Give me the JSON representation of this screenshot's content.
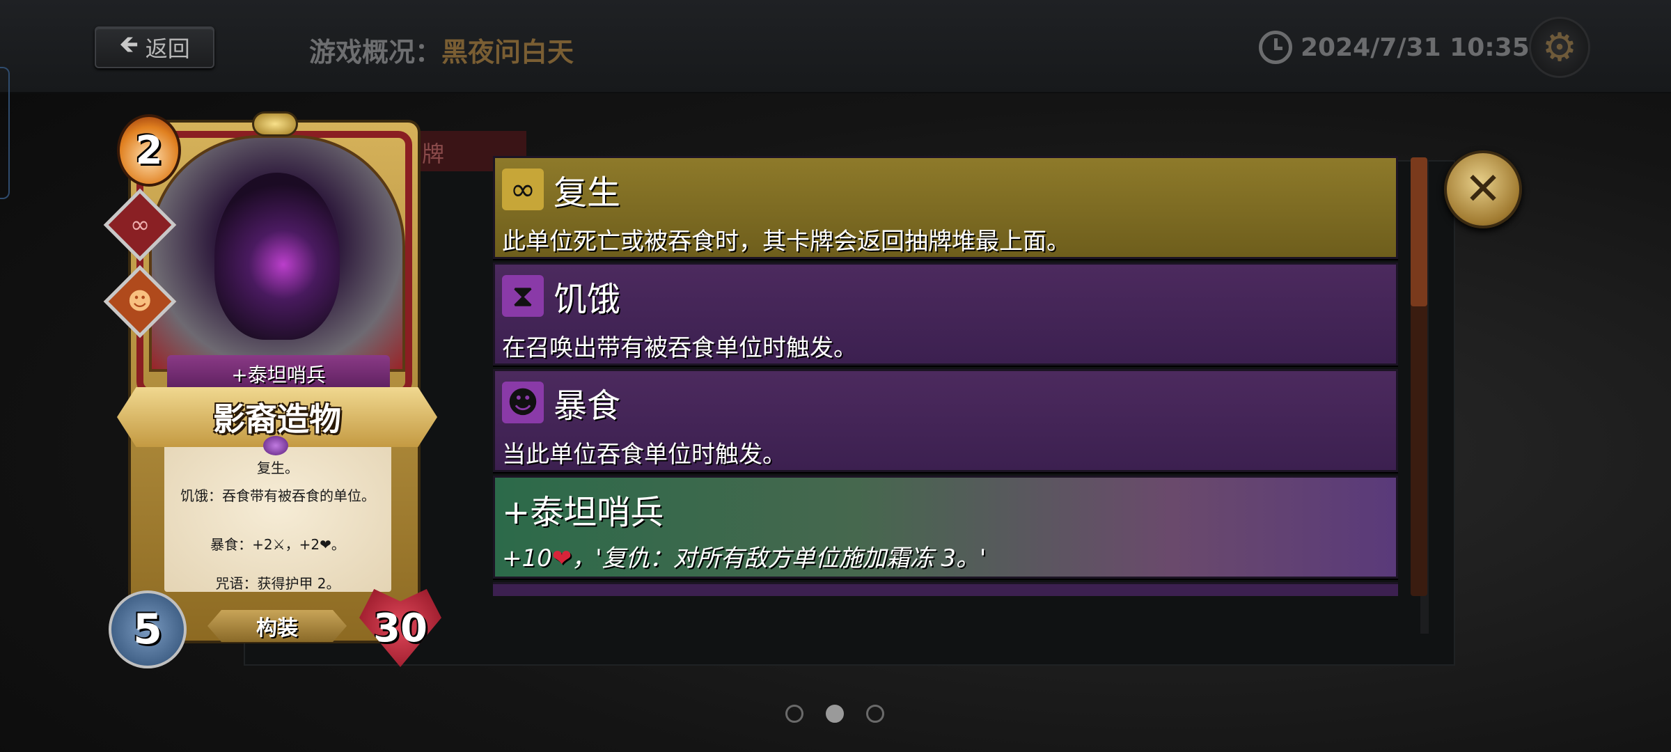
{
  "header": {
    "back_label": "返回",
    "back_arrow": "🡸",
    "overview_prefix": "游戏概况：",
    "overview_name": "黑夜问白天",
    "datetime": "2024/7/31 10:35",
    "settings_glyph": "⚙"
  },
  "panel": {
    "tab_label": "牌",
    "close_glyph": "✕"
  },
  "keywords": [
    {
      "icon_glyph": "∞",
      "title": "复生",
      "desc": "此单位死亡或被吞食时，其卡牌会返回抽牌堆最上面。"
    },
    {
      "icon_glyph": "⧗",
      "title": "饥饿",
      "desc": "在召唤出带有被吞食单位时触发。"
    },
    {
      "icon_glyph": "☻",
      "title": "暴食",
      "desc": "当此单位吞食单位时触发。"
    }
  ],
  "upgrade": {
    "title": "+泰坦哨兵",
    "desc_prefix": "+10",
    "desc_heart": "❤",
    "desc_rest": "，'复仇：对所有敌方单位施加霜冻 3。'"
  },
  "pager": {
    "count": 3,
    "active": 2
  },
  "card": {
    "mana": "2",
    "badge1_glyph": "∞",
    "badge2_glyph": "☻",
    "subtitle": "+泰坦哨兵",
    "name": "影裔造物",
    "text_line1": "复生。",
    "text_line2": "饥饿：吞食带有被吞食的单位。",
    "text_line3": "暴食：+2⚔，+2❤。",
    "text_line4": "咒语：获得护甲 2。",
    "type": "构装",
    "attack": "5",
    "health": "30"
  },
  "colors": {
    "gold_keyword": "#8e7a2a",
    "purple_keyword": "#4c2a5e",
    "accent_name": "#7a5e33"
  }
}
